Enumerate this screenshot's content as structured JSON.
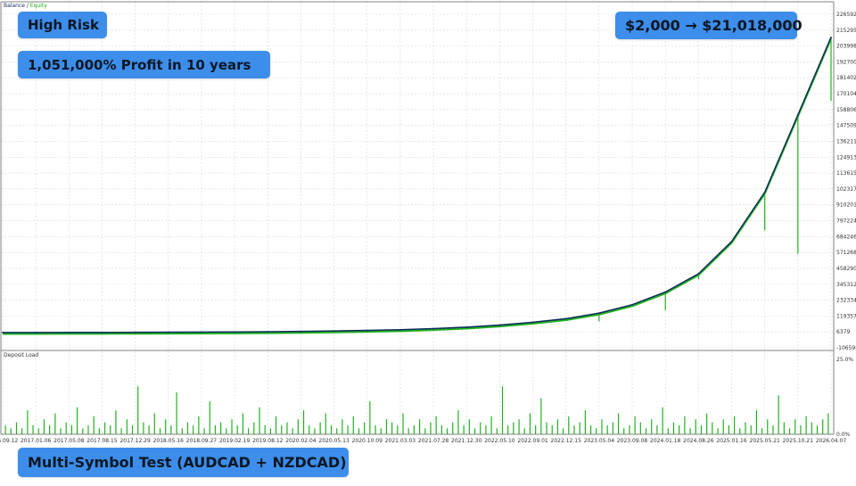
{
  "legend": {
    "balance": "Balance",
    "sep": " / ",
    "equity": "Equity"
  },
  "lower_title": "Deposit Load",
  "badges": {
    "risk": "High Risk",
    "profit": "1,051,000% Profit in 10 years",
    "growth": "$2,000 → $21,018,000",
    "test": "Multi-Symbol Test (AUDCAD + NZDCAD)"
  },
  "colors": {
    "balance": "#0d2b5c",
    "equity": "#22b022",
    "load": "#22b022",
    "badge": "#3d8eea",
    "grid": "#d8d8d8",
    "axis": "#808080"
  },
  "chart_data": [
    {
      "type": "line",
      "title": "",
      "xlabel": "",
      "ylabel": "",
      "grid": true,
      "legend": "top-left",
      "x": [
        "2016.09.12",
        "2017.01.06",
        "2017.05.08",
        "2017.08.15",
        "2017.12.29",
        "2018.05.16",
        "2018.09.27",
        "2019.02.19",
        "2019.08.12",
        "2020.02.04",
        "2020.05.13",
        "2020.10.09",
        "2021.03.03",
        "2021.07.28",
        "2021.12.30",
        "2022.05.10",
        "2022.09.01",
        "2022.12.15",
        "2023.05.04",
        "2023.09.08",
        "2024.01.18",
        "2024.08.26",
        "2025.01.16",
        "2025.05.21",
        "2025.10.21",
        "2026.04.07"
      ],
      "y_ticks": [
        "2265928",
        "2152958",
        "2039980",
        "1927002",
        "1814024",
        "1701046",
        "1588068",
        "1475091",
        "1362113",
        "1249135",
        "1136157",
        "1023179",
        "910201",
        "797224",
        "684246",
        "571268",
        "458290",
        "345312",
        "232334",
        "119357",
        "6379",
        "-106598"
      ],
      "ylim": [
        -106598,
        2265928
      ],
      "series": [
        {
          "name": "Balance",
          "values": [
            2000,
            2200,
            2500,
            3000,
            3500,
            4200,
            5000,
            6200,
            7800,
            10000,
            13000,
            17000,
            22000,
            30000,
            40000,
            55000,
            75000,
            100000,
            140000,
            200000,
            290000,
            420000,
            650000,
            1000000,
            1550000,
            2102000
          ]
        },
        {
          "name": "Equity",
          "values": [
            2000,
            2200,
            2500,
            3000,
            3500,
            4200,
            5000,
            6200,
            7800,
            10000,
            13000,
            17000,
            22000,
            30000,
            40000,
            55000,
            75000,
            100000,
            140000,
            200000,
            290000,
            420000,
            650000,
            1000000,
            1550000,
            2102000
          ],
          "drawdowns": [
            {
              "x": "2023.05.04",
              "value": 80000
            },
            {
              "x": "2024.01.18",
              "value": 160000
            },
            {
              "x": "2024.08.26",
              "value": 380000
            },
            {
              "x": "2025.05.21",
              "value": 730000
            },
            {
              "x": "2025.10.21",
              "value": 560000
            },
            {
              "x": "2026.04.07",
              "value": 1650000
            }
          ]
        }
      ]
    },
    {
      "type": "bar",
      "title": "Deposit Load",
      "xlabel": "",
      "ylabel": "",
      "grid": true,
      "y_ticks": [
        "25.0%",
        "0.0%"
      ],
      "ylim": [
        0,
        25
      ],
      "x_range": [
        "2016.09.12",
        "2026.04.07"
      ],
      "values": [
        3,
        2,
        4,
        2,
        8,
        3,
        2,
        5,
        3,
        7,
        2,
        4,
        3,
        9,
        2,
        3,
        6,
        2,
        4,
        3,
        8,
        2,
        5,
        3,
        16,
        4,
        3,
        7,
        2,
        5,
        3,
        14,
        2,
        4,
        3,
        6,
        2,
        11,
        3,
        4,
        2,
        5,
        3,
        7,
        2,
        4,
        9,
        3,
        2,
        6,
        3,
        4,
        2,
        5,
        8,
        3,
        2,
        4,
        7,
        3,
        2,
        5,
        3,
        6,
        2,
        4,
        11,
        3,
        2,
        5,
        4,
        3,
        7,
        2,
        3,
        5,
        2,
        4,
        6,
        3,
        2,
        4,
        8,
        3,
        5,
        2,
        4,
        3,
        6,
        2,
        16,
        3,
        4,
        5,
        2,
        7,
        3,
        12,
        4,
        3,
        5,
        2,
        6,
        3,
        4,
        8,
        3,
        2,
        5,
        3,
        4,
        7,
        2,
        3,
        6,
        4,
        2,
        5,
        3,
        9,
        2,
        4,
        3,
        6,
        2,
        5,
        3,
        7,
        4,
        2,
        5,
        3,
        6,
        2,
        4,
        3,
        8,
        2,
        5,
        3,
        13,
        4,
        2,
        5,
        3,
        6,
        4,
        3,
        5,
        7
      ]
    }
  ]
}
